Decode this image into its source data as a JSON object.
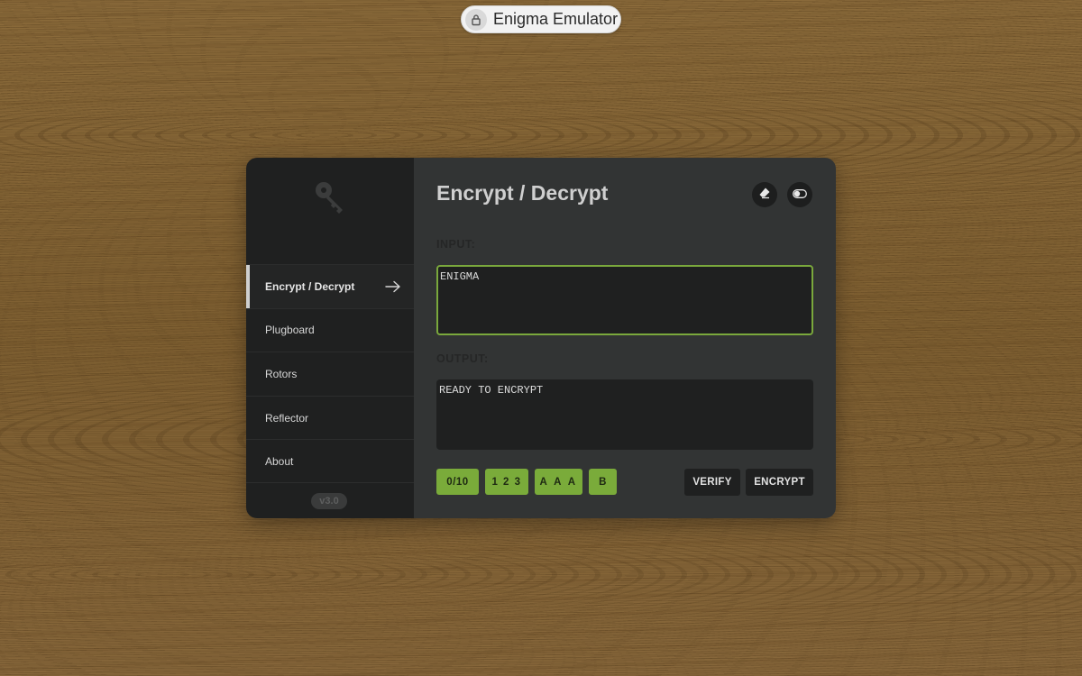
{
  "app": {
    "title": "Enigma Emulator",
    "title_icon": "lock-icon"
  },
  "sidebar": {
    "logo_icon": "key-icon",
    "items": [
      {
        "label": "Encrypt / Decrypt",
        "active": true
      },
      {
        "label": "Plugboard"
      },
      {
        "label": "Rotors"
      },
      {
        "label": "Reflector"
      },
      {
        "label": "About"
      }
    ],
    "version": "v3.0"
  },
  "main": {
    "heading": "Encrypt / Decrypt",
    "input_label": "INPUT:",
    "input_value": "ENIGMA",
    "output_label": "OUTPUT:",
    "output_value": "READY TO ENCRYPT",
    "settings": {
      "plugboard": "0/10",
      "rotors": "1 2 3",
      "positions": "A A A",
      "reflector": "B"
    },
    "buttons": {
      "verify": "VERIFY",
      "encrypt": "ENCRYPT"
    }
  },
  "colors": {
    "accent": "#7aab3a",
    "panel": "#323434",
    "sidebar": "#1f2020"
  }
}
